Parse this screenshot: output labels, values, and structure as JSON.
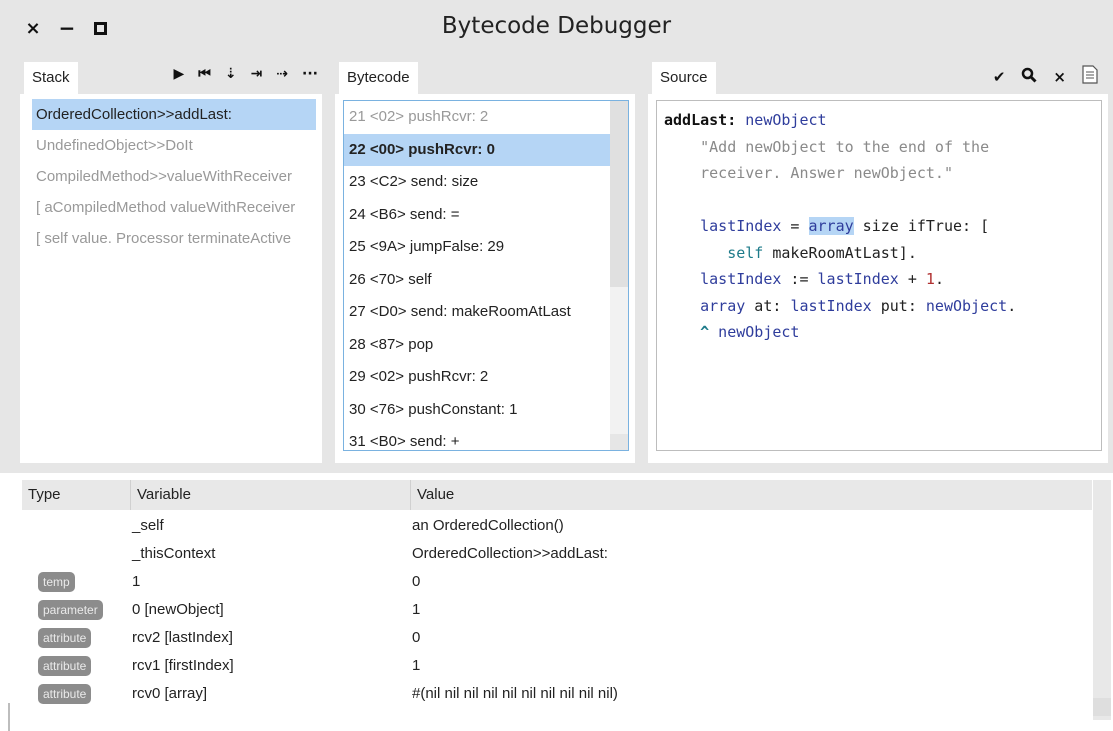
{
  "window": {
    "title": "Bytecode Debugger",
    "close_glyph": "×",
    "minimize_glyph": "−"
  },
  "stack_pane": {
    "tab_label": "Stack",
    "toolbar": [
      {
        "icon": "play-icon",
        "glyph": "▶"
      },
      {
        "icon": "restart-icon",
        "glyph": "⏮"
      },
      {
        "icon": "step-into-icon",
        "glyph": "⇣"
      },
      {
        "icon": "step-over-icon",
        "glyph": "⇥"
      },
      {
        "icon": "step-through-icon",
        "glyph": "⇢"
      },
      {
        "icon": "more-icon",
        "glyph": "···"
      }
    ],
    "frames": [
      "OrderedCollection>>addLast:",
      "UndefinedObject>>DoIt",
      "CompiledMethod>>valueWithReceiver",
      "[ aCompiledMethod valueWithReceiver",
      "[ self value. Processor terminateActive"
    ],
    "selected_index": 0
  },
  "bytecode_pane": {
    "tab_label": "Bytecode",
    "rows": [
      "21 <02> pushRcvr: 2",
      "22 <00> pushRcvr: 0",
      "23 <C2> send: size",
      "24 <B6> send: =",
      "25 <9A> jumpFalse: 29",
      "26 <70> self",
      "27 <D0> send: makeRoomAtLast",
      "28 <87> pop",
      "29 <02> pushRcvr: 2",
      "30 <76> pushConstant: 1",
      "31 <B0> send: +"
    ],
    "selected_index": 1
  },
  "source_pane": {
    "tab_label": "Source",
    "toolbar": [
      {
        "icon": "accept-icon",
        "glyph": "✔"
      },
      {
        "icon": "search-icon",
        "glyph": "🔍"
      },
      {
        "icon": "cancel-icon",
        "glyph": "×"
      },
      {
        "icon": "document-icon",
        "glyph": "≣"
      }
    ],
    "code": {
      "selector": "addLast:",
      "argument": "newObject",
      "comment_line1": "\"Add newObject to the end of the",
      "comment_line2": "receiver. Answer newObject.\"",
      "line1_a": "lastIndex",
      "line1_b": " = ",
      "line1_c": "array",
      "line1_d": " size ifTrue: [",
      "line2_a": "self",
      "line2_b": " makeRoomAtLast].",
      "line3_a": "lastIndex",
      "line3_b": " := ",
      "line3_c": "lastIndex",
      "line3_d": " + ",
      "line3_e": "1",
      "line3_f": ".",
      "line4_a": "array",
      "line4_b": " at: ",
      "line4_c": "lastIndex",
      "line4_d": " put: ",
      "line4_e": "newObject",
      "line4_f": ".",
      "line5_a": "^",
      "line5_b": " newObject"
    }
  },
  "inspector": {
    "columns": {
      "type": "Type",
      "variable": "Variable",
      "value": "Value"
    },
    "rows": [
      {
        "type": "",
        "variable": "_self",
        "value": "an OrderedCollection()"
      },
      {
        "type": "",
        "variable": "_thisContext",
        "value": "OrderedCollection>>addLast:"
      },
      {
        "type": "temp",
        "variable": "1",
        "value": "0"
      },
      {
        "type": "parameter",
        "variable": "0 [newObject]",
        "value": "1"
      },
      {
        "type": "attribute",
        "variable": "rcv2 [lastIndex]",
        "value": "0"
      },
      {
        "type": "attribute",
        "variable": "rcv1 [firstIndex]",
        "value": "1"
      },
      {
        "type": "attribute",
        "variable": "rcv0 [array]",
        "value": "#(nil nil nil nil nil nil nil nil nil nil)"
      }
    ]
  },
  "colors": {
    "selection": "#b5d5f5",
    "chrome": "#e6e6e6",
    "badge": "#8c8c8c",
    "code_blue": "#2f3d9c",
    "code_number": "#b03030"
  }
}
